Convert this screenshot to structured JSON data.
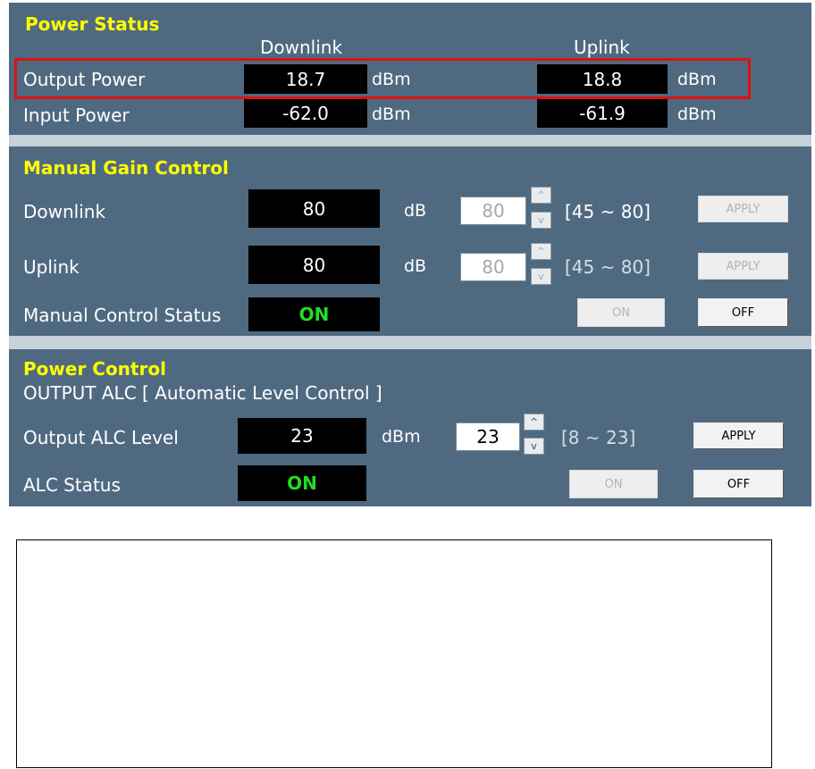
{
  "power_status": {
    "title": "Power Status",
    "col_downlink": "Downlink",
    "col_uplink": "Uplink",
    "rows": [
      {
        "label": "Output Power",
        "downlink": "18.7",
        "downlink_unit": "dBm",
        "uplink": "18.8",
        "uplink_unit": "dBm"
      },
      {
        "label": "Input Power",
        "downlink": "-62.0",
        "downlink_unit": "dBm",
        "uplink": "-61.9",
        "uplink_unit": "dBm"
      }
    ]
  },
  "manual_gain": {
    "title": "Manual Gain Control",
    "downlink": {
      "label": "Downlink",
      "value": "80",
      "unit": "dB",
      "input": "80",
      "range": "[45 ~ 80]",
      "apply": "APPLY"
    },
    "uplink": {
      "label": "Uplink",
      "value": "80",
      "unit": "dB",
      "input": "80",
      "range": "[45 ~ 80]",
      "apply": "APPLY"
    },
    "status": {
      "label": "Manual Control Status",
      "value": "ON",
      "on_button": "ON",
      "off_button": "OFF"
    }
  },
  "power_control": {
    "title": "Power Control",
    "subtitle": "OUTPUT ALC [ Automatic Level Control ]",
    "level": {
      "label": "Output ALC Level",
      "value": "23",
      "unit": "dBm",
      "input": "23",
      "range": "[8 ~ 23]",
      "apply": "APPLY"
    },
    "status": {
      "label": "ALC Status",
      "value": "ON",
      "on_button": "ON",
      "off_button": "OFF"
    }
  },
  "icons": {
    "spin_up": "^",
    "spin_down": "v"
  },
  "colors": {
    "panel_bg": "#4f6a80",
    "title": "#ffff00",
    "status_on": "#22dd22",
    "highlight": "#e01010"
  }
}
